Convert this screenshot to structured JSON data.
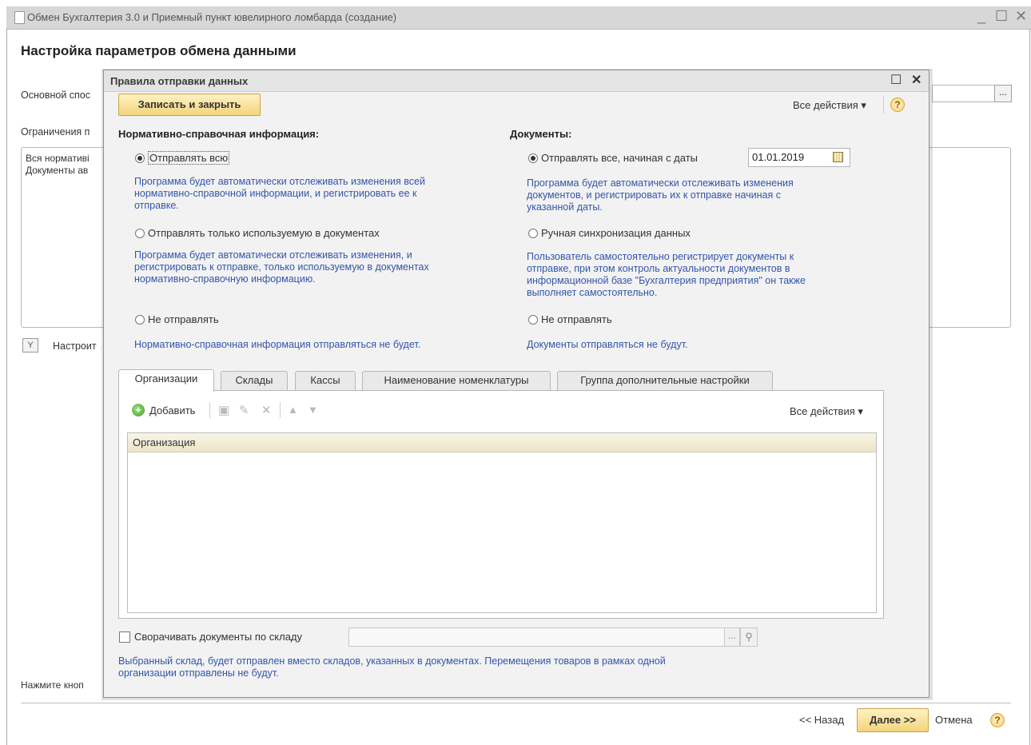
{
  "window": {
    "title": "Обмен Бухгалтерия 3.0 и Приемный пункт ювелирного ломбарда (создание)",
    "minimize": "_",
    "maximize": "☐",
    "close": "✕"
  },
  "background": {
    "heading": "Настройка параметров обмена данными",
    "main_method_label": "Основной спос",
    "main_method_dots": "...",
    "restrictions_label": "Ограничения п",
    "area_line1": "Вся нормативі",
    "area_line2": "Документы ав",
    "configure_button": "Настроит",
    "hint_text": "Нажмите кноп"
  },
  "footer": {
    "back": "<< Назад",
    "next": "Далее >>",
    "cancel": "Отмена",
    "help": "?"
  },
  "dialog": {
    "title": "Правила отправки данных",
    "maximize": "☐",
    "close": "✕",
    "save_close": "Записать и закрыть",
    "all_actions": "Все действия",
    "all_actions_arrow": "▾",
    "help": "?",
    "nsi": {
      "heading": "Нормативно-справочная информация:",
      "options": [
        {
          "label": "Отправлять всю",
          "selected": true,
          "hint": [
            "Программа будет автоматически отслеживать изменения всей",
            "нормативно-справочной информации, и регистрировать ее к",
            "отправке."
          ]
        },
        {
          "label": "Отправлять только используемую в документах",
          "selected": false,
          "hint": [
            "Программа будет автоматически отслеживать изменения, и",
            "регистрировать к отправке, только используемую в документах",
            "нормативно-справочную информацию."
          ]
        },
        {
          "label": "Не отправлять",
          "selected": false,
          "hint": [
            "Нормативно-справочная информация отправляться не будет."
          ]
        }
      ]
    },
    "docs": {
      "heading": "Документы:",
      "date_value": "01.01.2019",
      "options": [
        {
          "label": "Отправлять все, начиная с даты",
          "selected": true,
          "hint": [
            "Программа будет автоматически отслеживать изменения",
            "документов, и регистрировать их к отправке начиная с",
            "указанной даты."
          ]
        },
        {
          "label": "Ручная синхронизация данных",
          "selected": false,
          "hint": [
            "Пользователь самостоятельно регистрирует документы к",
            "отправке, при этом контроль актуальности документов в",
            "информационной базе \"Бухгалтерия предприятия\" он также",
            "выполняет самостоятельно."
          ]
        },
        {
          "label": "Не отправлять",
          "selected": false,
          "hint": [
            "Документы отправляться не будут."
          ]
        }
      ]
    },
    "tabs": [
      "Организации",
      "Склады",
      "Кассы",
      "Наименование номенклатуры",
      "Группа дополнительные настройки"
    ],
    "toolbar": {
      "add": "Добавить",
      "add_icon": "+",
      "copy_icon": "▣",
      "edit_icon": "✎",
      "delete_icon": "✕",
      "up_icon": "▲",
      "down_icon": "▼",
      "all_actions": "Все действия",
      "arrow": "▾"
    },
    "grid": {
      "column": "Организация",
      "rows": []
    },
    "collapse": {
      "checkbox_label": "Сворачивать документы по складу",
      "checked": false,
      "field_value": "",
      "dots": "...",
      "search_icon": "⚲",
      "hint": [
        "Выбранный склад, будет отправлен  вместо складов, указанных в документах. Перемещения товаров в рамках одной",
        "организации отправлены не будут."
      ]
    }
  },
  "colors": {
    "hint_blue": "#3355aa",
    "accent_button": "#f4d47c",
    "dialog_bg": "#f2f2f2"
  }
}
